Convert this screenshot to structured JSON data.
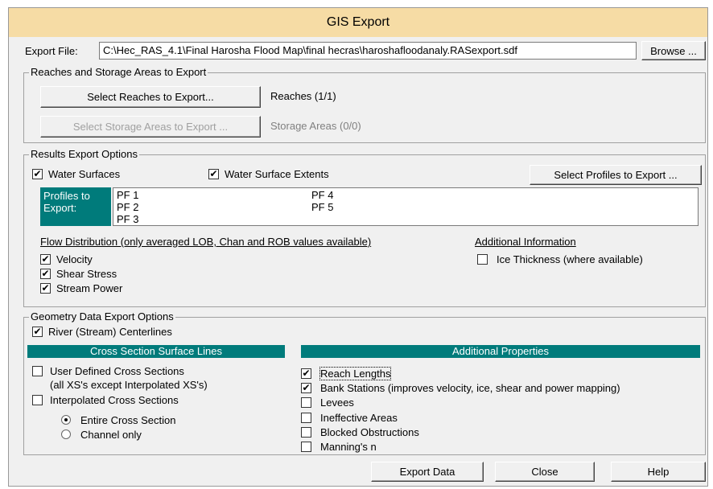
{
  "window": {
    "title": "GIS Export"
  },
  "export_file": {
    "label": "Export File:",
    "value": "C:\\Hec_RAS_4.1\\Final Harosha Flood Map\\final hecras\\haroshafloodanaly.RASexport.sdf",
    "browse": "Browse ..."
  },
  "reaches": {
    "legend": "Reaches and Storage Areas to Export",
    "select_reaches": "Select Reaches to Export...",
    "reaches_status": "Reaches (1/1)",
    "select_storage": "Select Storage Areas to Export ...",
    "storage_status": "Storage Areas (0/0)"
  },
  "results": {
    "legend": "Results Export Options",
    "water_surfaces": "Water Surfaces",
    "water_surfaces_checked": true,
    "extents": "Water Surface Extents",
    "extents_checked": true,
    "select_profiles": "Select Profiles to Export ...",
    "profiles_label": "Profiles to Export:",
    "profiles_col1": [
      "PF 1",
      "PF 2",
      "PF 3"
    ],
    "profiles_col2": [
      "PF 4",
      "PF 5"
    ],
    "flow_heading": "Flow Distribution (only averaged LOB, Chan and ROB values available)",
    "velocity": "Velocity",
    "shear": "Shear Stress",
    "stream_power": "Stream Power",
    "additional_heading": "Additional Information",
    "ice": "Ice Thickness (where available)"
  },
  "geometry": {
    "legend": "Geometry Data Export Options",
    "centerlines": "River (Stream) Centerlines",
    "xs_header": "Cross Section Surface Lines",
    "user_defined": "User Defined Cross Sections",
    "user_defined_note": "(all XS's except Interpolated XS's)",
    "interpolated": "Interpolated Cross Sections",
    "entire": "Entire Cross Section",
    "channel_only": "Channel only",
    "props_header": "Additional Properties",
    "reach_lengths": "Reach Lengths",
    "bank_stations": "Bank Stations (improves velocity, ice, shear and power mapping)",
    "levees": "Levees",
    "ineffective": "Ineffective Areas",
    "blocked": "Blocked Obstructions",
    "mannings": "Manning's n"
  },
  "buttons": {
    "export": "Export Data",
    "close": "Close",
    "help": "Help"
  }
}
